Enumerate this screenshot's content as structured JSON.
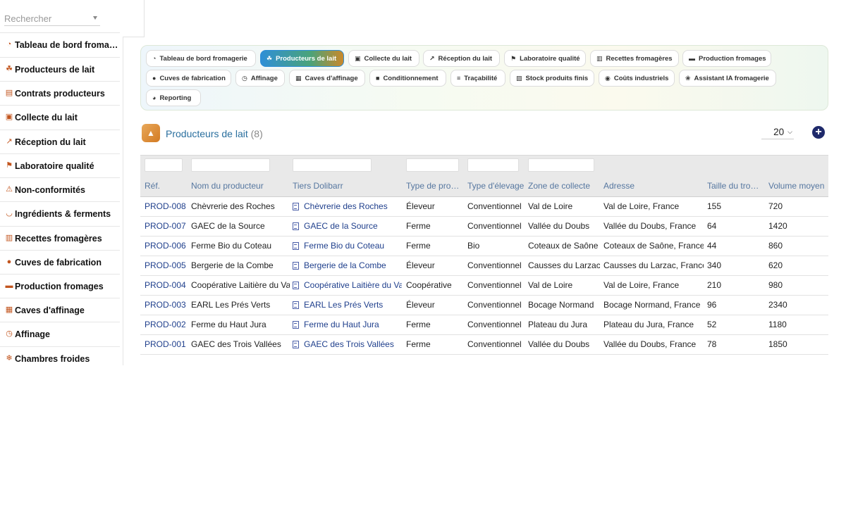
{
  "sidebar": {
    "search_placeholder": "Rechercher",
    "items": [
      {
        "label": "Tableau de bord fromagerie",
        "icon": "gauge-icon",
        "color": "#c2551e"
      },
      {
        "label": "Producteurs de lait",
        "icon": "farmer-tractor-icon",
        "color": "#c2551e"
      },
      {
        "label": "Contrats producteurs",
        "icon": "contract-icon",
        "color": "#c2551e"
      },
      {
        "label": "Collecte du lait",
        "icon": "truck-icon",
        "color": "#c2551e"
      },
      {
        "label": "Réception du lait",
        "icon": "dolly-icon",
        "color": "#c2551e"
      },
      {
        "label": "Laboratoire qualité",
        "icon": "microscope-icon",
        "color": "#c2551e"
      },
      {
        "label": "Non-conformités",
        "icon": "warning-icon",
        "color": "#c2551e"
      },
      {
        "label": "Ingrédients & ferments",
        "icon": "mortar-icon",
        "color": "#c2551e"
      },
      {
        "label": "Recettes fromagères",
        "icon": "book-icon",
        "color": "#c2551e"
      },
      {
        "label": "Cuves de fabrication",
        "icon": "drop-icon",
        "color": "#c2551e"
      },
      {
        "label": "Production fromages",
        "icon": "industry-icon",
        "color": "#c2551e"
      },
      {
        "label": "Caves d'affinage",
        "icon": "warehouse-icon",
        "color": "#c2551e"
      },
      {
        "label": "Affinage",
        "icon": "clock-icon",
        "color": "#c2551e"
      },
      {
        "label": "Chambres froides",
        "icon": "snowflake-icon",
        "color": "#c2551e"
      }
    ]
  },
  "tabs": [
    {
      "label": "Tableau de bord fromagerie",
      "icon": "gauge-icon",
      "active": false
    },
    {
      "label": "Producteurs de lait",
      "icon": "farmer-tractor-icon",
      "active": true
    },
    {
      "label": "Collecte du lait",
      "icon": "truck-icon",
      "active": false
    },
    {
      "label": "Réception du lait",
      "icon": "dolly-icon",
      "active": false
    },
    {
      "label": "Laboratoire qualité",
      "icon": "microscope-icon",
      "active": false
    },
    {
      "label": "Recettes fromagères",
      "icon": "book-icon",
      "active": false
    },
    {
      "label": "Production fromages",
      "icon": "industry-icon",
      "active": false
    },
    {
      "label": "Cuves de fabrication",
      "icon": "drop-icon",
      "active": false
    },
    {
      "label": "Affinage",
      "icon": "clock-icon",
      "active": false
    },
    {
      "label": "Caves d'affinage",
      "icon": "warehouse-icon",
      "active": false
    },
    {
      "label": "Conditionnement",
      "icon": "box-icon",
      "active": false
    },
    {
      "label": "Traçabilité",
      "icon": "barcode-icon",
      "active": false
    },
    {
      "label": "Stock produits finis",
      "icon": "boxes-icon",
      "active": false
    },
    {
      "label": "Coûts industriels",
      "icon": "coins-icon",
      "active": false
    },
    {
      "label": "Assistant IA fromagerie",
      "icon": "brain-icon",
      "active": false
    },
    {
      "label": "Reporting",
      "icon": "pie-chart-icon",
      "active": false
    }
  ],
  "page": {
    "title": "Producteurs de lait",
    "count": "(8)",
    "limit": "20"
  },
  "table": {
    "columns": [
      "Réf.",
      "Nom du producteur",
      "Tiers Dolibarr",
      "Type de producteur",
      "Type d'élevage",
      "Zone de collecte",
      "Adresse",
      "Taille du troupeau",
      "Volume moyen"
    ],
    "rows": [
      [
        "PROD-008",
        "Chèvrerie des Roches",
        "Chèvrerie des Roches",
        "Éleveur",
        "Conventionnel",
        "Val de Loire",
        "Val de Loire, France",
        "155",
        "720"
      ],
      [
        "PROD-007",
        "GAEC de la Source",
        "GAEC de la Source",
        "Ferme",
        "Conventionnel",
        "Vallée du Doubs",
        "Vallée du Doubs, France",
        "64",
        "1420"
      ],
      [
        "PROD-006",
        "Ferme Bio du Coteau",
        "Ferme Bio du Coteau",
        "Ferme",
        "Bio",
        "Coteaux de Saône",
        "Coteaux de Saône, France",
        "44",
        "860"
      ],
      [
        "PROD-005",
        "Bergerie de la Combe",
        "Bergerie de la Combe",
        "Éleveur",
        "Conventionnel",
        "Causses du Larzac",
        "Causses du Larzac, France",
        "340",
        "620"
      ],
      [
        "PROD-004",
        "Coopérative Laitière du Val",
        "Coopérative Laitière du Val",
        "Coopérative",
        "Conventionnel",
        "Val de Loire",
        "Val de Loire, France",
        "210",
        "980"
      ],
      [
        "PROD-003",
        "EARL Les Prés Verts",
        "EARL Les Prés Verts",
        "Éleveur",
        "Conventionnel",
        "Bocage Normand",
        "Bocage Normand, France",
        "96",
        "2340"
      ],
      [
        "PROD-002",
        "Ferme du Haut Jura",
        "Ferme du Haut Jura",
        "Ferme",
        "Conventionnel",
        "Plateau du Jura",
        "Plateau du Jura, France",
        "52",
        "1180"
      ],
      [
        "PROD-001",
        "GAEC des Trois Vallées",
        "GAEC des Trois Vallées",
        "Ferme",
        "Conventionnel",
        "Vallée du Doubs",
        "Vallée du Doubs, France",
        "78",
        "1850"
      ]
    ]
  }
}
